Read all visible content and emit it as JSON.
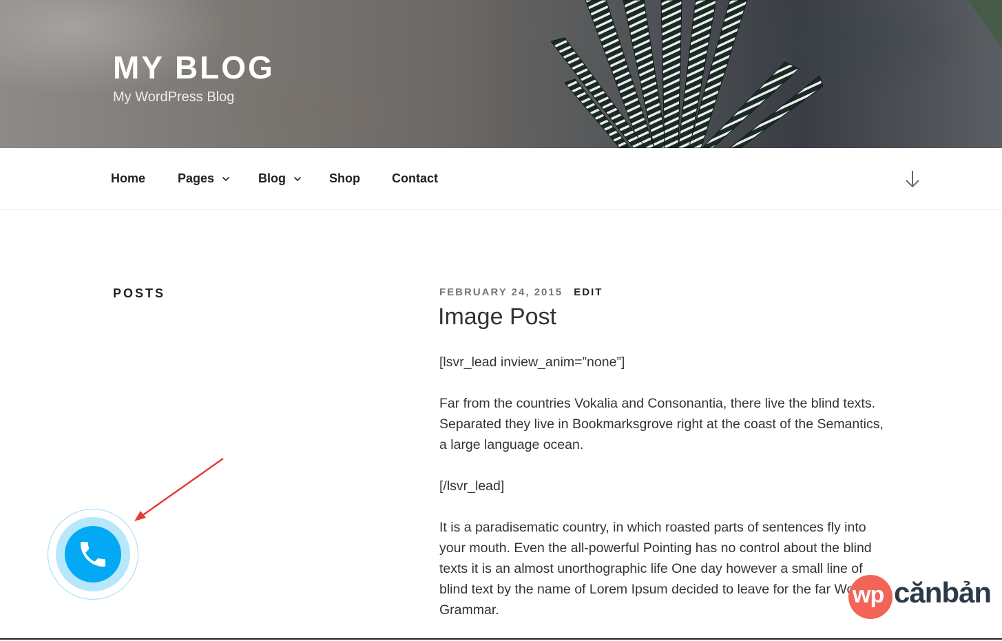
{
  "header": {
    "site_title": "MY BLOG",
    "site_description": "My WordPress Blog"
  },
  "nav": {
    "items": [
      {
        "label": "Home",
        "has_dropdown": false
      },
      {
        "label": "Pages",
        "has_dropdown": true
      },
      {
        "label": "Blog",
        "has_dropdown": true
      },
      {
        "label": "Shop",
        "has_dropdown": false
      },
      {
        "label": "Contact",
        "has_dropdown": false
      }
    ],
    "scroll_icon": "arrow-down-icon"
  },
  "sidebar": {
    "heading": "POSTS"
  },
  "post": {
    "date": "FEBRUARY 24, 2015",
    "edit_label": "EDIT",
    "title": "Image Post",
    "paragraphs": [
      "[lsvr_lead inview_anim=”none”]",
      "Far from the countries Vokalia and Consonantia, there live the blind texts. Separated they live in Bookmarksgrove right at the coast of the Semantics, a large language ocean.",
      "[/lsvr_lead]",
      "It is a paradisematic country, in which roasted parts of sentences fly into your mouth. Even the all-powerful Pointing has no control about the blind texts it is an almost unorthographic life One day however a small line of blind text by the name of Lorem Ipsum decided to leave for the far World of Grammar."
    ]
  },
  "call_button": {
    "icon": "phone-icon",
    "color": "#03a9f4",
    "halo_color": "#b7e7fb"
  },
  "annotation": {
    "arrow_color": "#e53935"
  },
  "watermark": {
    "part1": "wp",
    "part2": "cănbản",
    "badge_color": "#f26457",
    "text_color": "#2c3a48"
  }
}
